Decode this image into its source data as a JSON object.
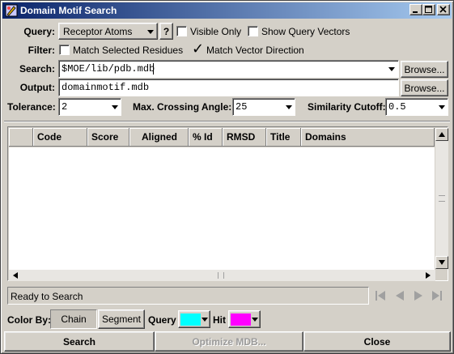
{
  "window": {
    "title": "Domain Motif Search"
  },
  "query": {
    "label": "Query:",
    "value": "Receptor Atoms",
    "help_label": "?",
    "visible_only_label": "Visible Only",
    "show_vectors_label": "Show Query Vectors"
  },
  "filter": {
    "label": "Filter:",
    "match_selected_label": "Match Selected Residues",
    "match_vector_label": "Match Vector Direction"
  },
  "search": {
    "label": "Search:",
    "value": "$MOE/lib/pdb.mdb",
    "browse_label": "Browse..."
  },
  "output": {
    "label": "Output:",
    "value": "domainmotif.mdb",
    "browse_label": "Browse..."
  },
  "params": {
    "tolerance_label": "Tolerance:",
    "tolerance_value": "2",
    "angle_label": "Max. Crossing Angle:",
    "angle_value": "25",
    "similarity_label": "Similarity Cutoff:",
    "similarity_value": "0.5"
  },
  "table": {
    "columns": [
      "",
      "Code",
      "Score",
      "Aligned",
      "% Id",
      "RMSD",
      "Title",
      "Domains"
    ]
  },
  "status": {
    "text": "Ready to Search"
  },
  "colorby": {
    "label": "Color By:",
    "chain_label": "Chain",
    "segment_label": "Segment",
    "query_label": "Query",
    "query_color": "#00ffff",
    "hit_label": "Hit",
    "hit_color": "#ff00ff"
  },
  "buttons": {
    "search": "Search",
    "optimize": "Optimize MDB...",
    "close": "Close"
  }
}
